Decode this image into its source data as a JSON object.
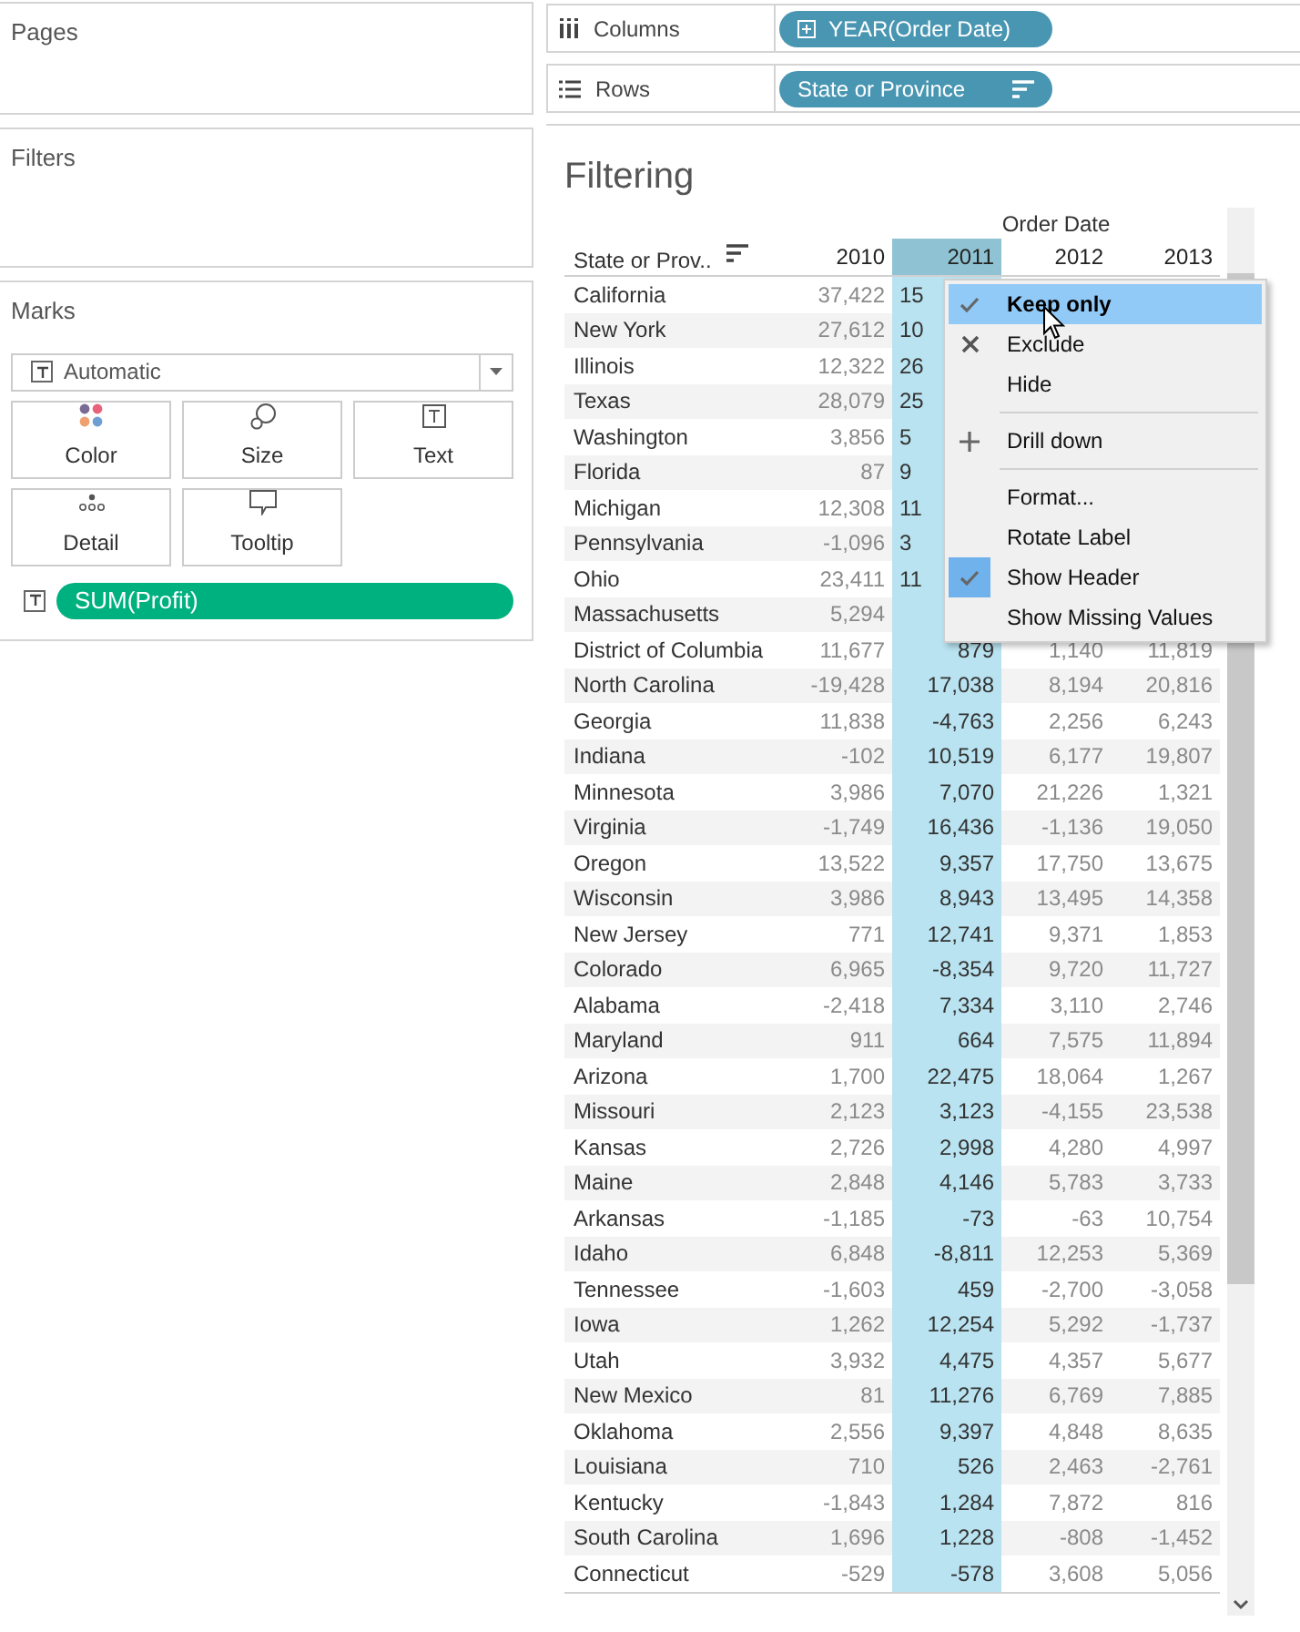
{
  "side_panels": [
    {
      "title": "Pages"
    },
    {
      "title": "Filters"
    }
  ],
  "marks": {
    "title": "Marks",
    "mark_type": "Automatic",
    "cards": [
      {
        "label": "Color",
        "kind": "color"
      },
      {
        "label": "Size",
        "kind": "size"
      },
      {
        "label": "Text",
        "kind": "text"
      },
      {
        "label": "Detail",
        "kind": "detail"
      },
      {
        "label": "Tooltip",
        "kind": "tooltip"
      }
    ],
    "pill": "SUM(Profit)"
  },
  "shelves": [
    {
      "label": "Columns",
      "kind": "columns",
      "pill": "YEAR(Order Date)"
    },
    {
      "label": "Rows",
      "kind": "rows",
      "pill": "State or Province"
    }
  ],
  "sheet": {
    "title": "Filtering",
    "column_group": "Order Date",
    "row_header": "State or Prov..",
    "columns": [
      {
        "label": "2010",
        "selected": false
      },
      {
        "label": "2011",
        "selected": true
      },
      {
        "label": "2012",
        "selected": false
      },
      {
        "label": "2013",
        "selected": false
      }
    ],
    "rows": [
      {
        "state": "California",
        "values": [
          "37,422",
          "15"
        ]
      },
      {
        "state": "New York",
        "values": [
          "27,612",
          "10"
        ]
      },
      {
        "state": "Illinois",
        "values": [
          "12,322",
          "26"
        ]
      },
      {
        "state": "Texas",
        "values": [
          "28,079",
          "25"
        ]
      },
      {
        "state": "Washington",
        "values": [
          "3,856",
          "5"
        ]
      },
      {
        "state": "Florida",
        "values": [
          "87",
          "9"
        ]
      },
      {
        "state": "Michigan",
        "values": [
          "12,308",
          "11"
        ]
      },
      {
        "state": "Pennsylvania",
        "values": [
          "-1,096",
          "3"
        ]
      },
      {
        "state": "Ohio",
        "values": [
          "23,411",
          "11"
        ]
      },
      {
        "state": "Massachusetts",
        "values": [
          "5,294"
        ]
      },
      {
        "state": "District of Columbia",
        "values": [
          "11,677",
          "879",
          "1,140",
          "11,819"
        ]
      },
      {
        "state": "North Carolina",
        "values": [
          "-19,428",
          "17,038",
          "8,194",
          "20,816"
        ]
      },
      {
        "state": "Georgia",
        "values": [
          "11,838",
          "-4,763",
          "2,256",
          "6,243"
        ]
      },
      {
        "state": "Indiana",
        "values": [
          "-102",
          "10,519",
          "6,177",
          "19,807"
        ]
      },
      {
        "state": "Minnesota",
        "values": [
          "3,986",
          "7,070",
          "21,226",
          "1,321"
        ]
      },
      {
        "state": "Virginia",
        "values": [
          "-1,749",
          "16,436",
          "-1,136",
          "19,050"
        ]
      },
      {
        "state": "Oregon",
        "values": [
          "13,522",
          "9,357",
          "17,750",
          "13,675"
        ]
      },
      {
        "state": "Wisconsin",
        "values": [
          "3,986",
          "8,943",
          "13,495",
          "14,358"
        ]
      },
      {
        "state": "New Jersey",
        "values": [
          "771",
          "12,741",
          "9,371",
          "1,853"
        ]
      },
      {
        "state": "Colorado",
        "values": [
          "6,965",
          "-8,354",
          "9,720",
          "11,727"
        ]
      },
      {
        "state": "Alabama",
        "values": [
          "-2,418",
          "7,334",
          "3,110",
          "2,746"
        ]
      },
      {
        "state": "Maryland",
        "values": [
          "911",
          "664",
          "7,575",
          "11,894"
        ]
      },
      {
        "state": "Arizona",
        "values": [
          "1,700",
          "22,475",
          "18,064",
          "1,267"
        ]
      },
      {
        "state": "Missouri",
        "values": [
          "2,123",
          "3,123",
          "-4,155",
          "23,538"
        ]
      },
      {
        "state": "Kansas",
        "values": [
          "2,726",
          "2,998",
          "4,280",
          "4,997"
        ]
      },
      {
        "state": "Maine",
        "values": [
          "2,848",
          "4,146",
          "5,783",
          "3,733"
        ]
      },
      {
        "state": "Arkansas",
        "values": [
          "-1,185",
          "-73",
          "-63",
          "10,754"
        ]
      },
      {
        "state": "Idaho",
        "values": [
          "6,848",
          "-8,811",
          "12,253",
          "5,369"
        ]
      },
      {
        "state": "Tennessee",
        "values": [
          "-1,603",
          "459",
          "-2,700",
          "-3,058"
        ]
      },
      {
        "state": "Iowa",
        "values": [
          "1,262",
          "12,254",
          "5,292",
          "-1,737"
        ]
      },
      {
        "state": "Utah",
        "values": [
          "3,932",
          "4,475",
          "4,357",
          "5,677"
        ]
      },
      {
        "state": "New Mexico",
        "values": [
          "81",
          "11,276",
          "6,769",
          "7,885"
        ]
      },
      {
        "state": "Oklahoma",
        "values": [
          "2,556",
          "9,397",
          "4,848",
          "8,635"
        ]
      },
      {
        "state": "Louisiana",
        "values": [
          "710",
          "526",
          "2,463",
          "-2,761"
        ]
      },
      {
        "state": "Kentucky",
        "values": [
          "-1,843",
          "1,284",
          "7,872",
          "816"
        ]
      },
      {
        "state": "South Carolina",
        "values": [
          "1,696",
          "1,228",
          "-808",
          "-1,452"
        ]
      },
      {
        "state": "Connecticut",
        "values": [
          "-529",
          "-578",
          "3,608",
          "5,056"
        ]
      }
    ]
  },
  "context_menu": [
    {
      "kind": "keep",
      "label": "Keep only",
      "highlighted": true,
      "checked": false
    },
    {
      "kind": "exclude",
      "label": "Exclude",
      "highlighted": false,
      "checked": false
    },
    {
      "kind": "plain",
      "label": "Hide",
      "highlighted": false,
      "checked": false
    },
    {
      "kind": "separator"
    },
    {
      "kind": "drill",
      "label": "Drill down",
      "highlighted": false,
      "checked": false
    },
    {
      "kind": "separator"
    },
    {
      "kind": "plain",
      "label": "Format...",
      "highlighted": false,
      "checked": false
    },
    {
      "kind": "plain",
      "label": "Rotate Label",
      "highlighted": false,
      "checked": false
    },
    {
      "kind": "plain",
      "label": "Show Header",
      "highlighted": false,
      "checked": true
    },
    {
      "kind": "plain",
      "label": "Show Missing Values",
      "highlighted": false,
      "checked": false
    }
  ]
}
